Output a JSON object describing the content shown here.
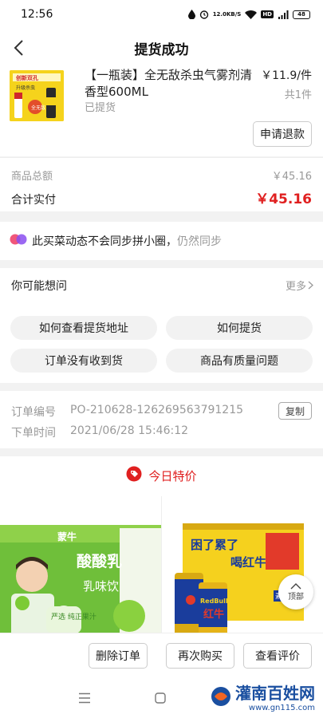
{
  "status_bar": {
    "time": "12:56",
    "net_speed_value": "12.0",
    "net_speed_unit": "KB/S",
    "hd": "HD",
    "signal": "4G",
    "battery": "48"
  },
  "nav": {
    "title": "提货成功"
  },
  "product": {
    "name": "【一瓶装】全无敌杀虫气雾剂清香型600ML",
    "status": "已提货",
    "price": "￥11.9/件",
    "qty": "共1件",
    "refund_label": "申请退款",
    "thumb_brand": "全无敌",
    "thumb_line1": "创新双孔",
    "thumb_line2": "升级杀虫"
  },
  "totals": {
    "goods_label": "商品总额",
    "goods_value": "￥45.16",
    "paid_label": "合计实付",
    "paid_value": "￥45.16"
  },
  "sync": {
    "text": "此买菜动态不会同步拼小圈，",
    "muted": "仍然同步"
  },
  "faq": {
    "title": "你可能想问",
    "more": "更多",
    "items": [
      "如何查看提货地址",
      "如何提货",
      "订单没有收到货",
      "商品有质量问题"
    ]
  },
  "order": {
    "no_label": "订单编号",
    "no_value": "PO-210628-126269563791215",
    "copy_label": "复制",
    "time_label": "下单时间",
    "time_value": "2021/06/28 15:46:12"
  },
  "deals": {
    "title": "今日特价",
    "left": {
      "brand": "蒙牛",
      "name": "酸酸乳",
      "flavor": "乳味饮",
      "tag": "严选\n纯正果汁"
    },
    "right": {
      "banner1": "困了累了",
      "banner2": "喝红牛",
      "can_label": "RedBull",
      "can_cn": "红牛",
      "side": "素功能"
    }
  },
  "top_button": "顶部",
  "actions": {
    "delete": "删除订单",
    "rebuy": "再次购买",
    "review": "查看评价"
  },
  "watermark": {
    "name": "灌南百姓网",
    "url": "www.gn115.com"
  },
  "colors": {
    "accent_red": "#e02020",
    "muted": "#999999",
    "background": "#f2f2f2"
  }
}
